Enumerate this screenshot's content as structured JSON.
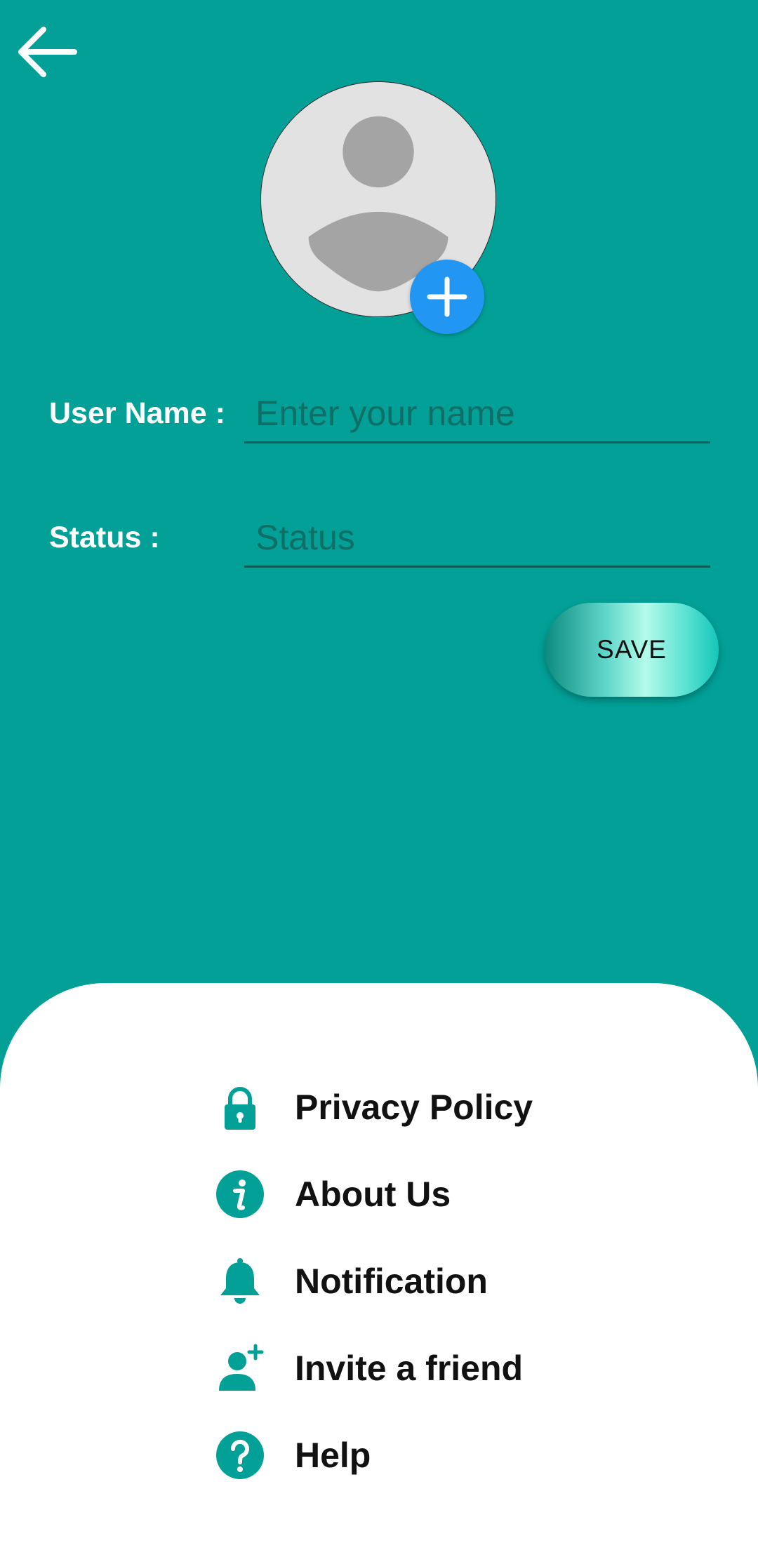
{
  "colors": {
    "background": "#02A097",
    "accent": "#2196F3",
    "sheet": "#FFFFFF",
    "icon": "#02A097"
  },
  "header": {
    "back_icon": "arrow-left-icon"
  },
  "profile": {
    "avatar_icon": "person-placeholder-icon",
    "add_photo_icon": "plus-icon"
  },
  "form": {
    "username_label": "User Name :",
    "username_placeholder": "Enter your name",
    "username_value": "",
    "status_label": "Status :",
    "status_placeholder": "Status",
    "status_value": "",
    "save_label": "SAVE"
  },
  "menu": [
    {
      "label": "Privacy Policy",
      "icon": "lock-icon"
    },
    {
      "label": "About Us",
      "icon": "info-icon"
    },
    {
      "label": "Notification",
      "icon": "bell-icon"
    },
    {
      "label": "Invite a friend",
      "icon": "add-person-icon"
    },
    {
      "label": "Help",
      "icon": "help-icon"
    }
  ]
}
